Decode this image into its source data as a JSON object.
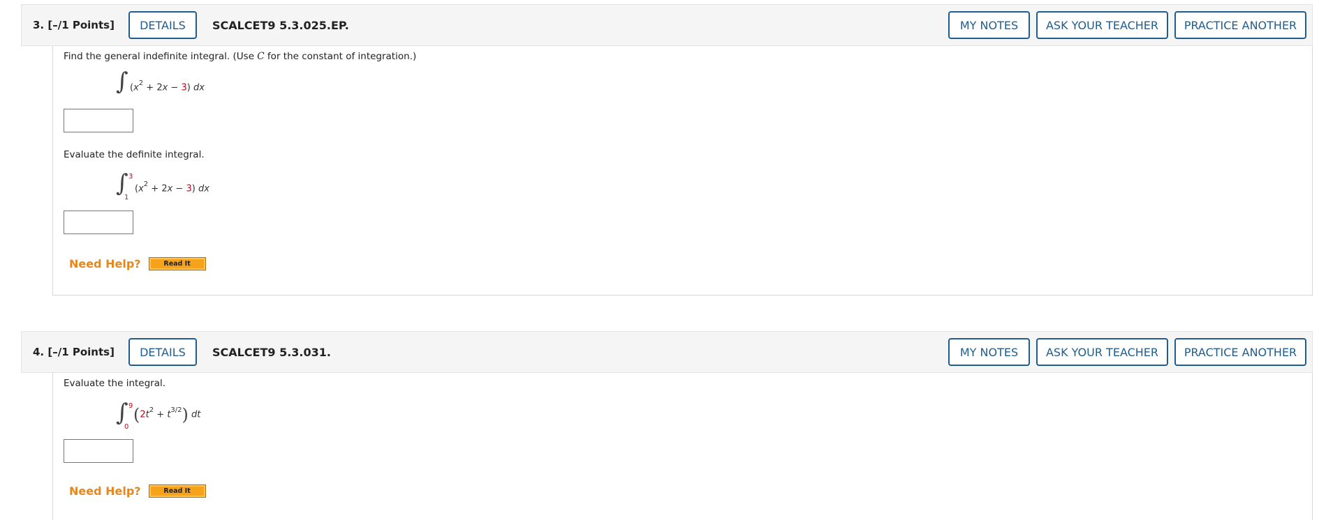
{
  "questions": [
    {
      "number": "3.",
      "points": "[–/1 Points]",
      "details_label": "DETAILS",
      "code": "SCALCET9 5.3.025.EP.",
      "my_notes_label": "MY NOTES",
      "ask_teacher_label": "ASK YOUR TEACHER",
      "practice_label": "PRACTICE ANOTHER",
      "part1_prompt_start": "Find the general indefinite integral. (Use ",
      "part1_prompt_var": "C",
      "part1_prompt_end": " for the constant of integration.)",
      "part1_integral": {
        "sign": "∫",
        "open": "(",
        "x": "x",
        "exp": "2",
        "mid": " + 2",
        "x2": "x",
        "minus": " − ",
        "const": "3",
        "close": ")",
        "dx": "dx"
      },
      "part1_answer": "",
      "part2_prompt": "Evaluate the definite integral.",
      "part2_integral": {
        "sign": "∫",
        "upper": "3",
        "lower": "1",
        "open": "(",
        "x": "x",
        "exp": "2",
        "mid": " + 2",
        "x2": "x",
        "minus": " − ",
        "const": "3",
        "close": ")",
        "dx": "dx"
      },
      "part2_answer": "",
      "need_help": "Need Help?",
      "read_it": "Read It"
    },
    {
      "number": "4.",
      "points": "[–/1 Points]",
      "details_label": "DETAILS",
      "code": "SCALCET9 5.3.031.",
      "my_notes_label": "MY NOTES",
      "ask_teacher_label": "ASK YOUR TEACHER",
      "practice_label": "PRACTICE ANOTHER",
      "prompt": "Evaluate the integral.",
      "integral": {
        "sign": "∫",
        "upper": "9",
        "lower": "0",
        "open": "(",
        "coef": "2",
        "t": "t",
        "exp": "2",
        "plus": " + ",
        "t2": "t",
        "exp2": "3/2",
        "close": ")",
        "dt": "dt"
      },
      "answer": "",
      "need_help": "Need Help?",
      "read_it": "Read It"
    }
  ],
  "colors": {
    "button_border": "#1f5c8f",
    "header_bg": "#f5f5f5",
    "help_orange": "#e8861b",
    "readit_bg": "#f7a21b",
    "math_red": "#d0021b"
  }
}
